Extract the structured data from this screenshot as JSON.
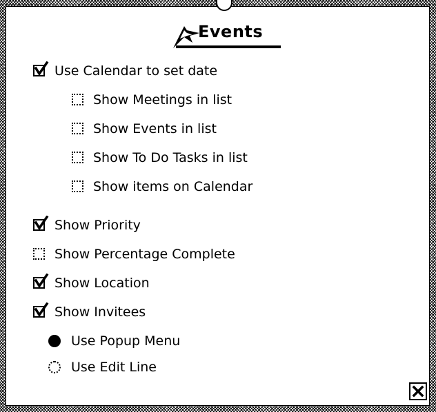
{
  "window": {
    "title": "Events"
  },
  "options": [
    {
      "label": "Use Calendar to set date",
      "checked": true
    },
    {
      "label": "Show Meetings in list",
      "checked": false
    },
    {
      "label": "Show Events in list",
      "checked": false
    },
    {
      "label": "Show To Do Tasks in list",
      "checked": false
    },
    {
      "label": "Show items on Calendar",
      "checked": false
    },
    {
      "label": "Show Priority",
      "checked": true
    },
    {
      "label": "Show Percentage Complete",
      "checked": false
    },
    {
      "label": "Show Location",
      "checked": true
    },
    {
      "label": "Show Invitees",
      "checked": true
    }
  ],
  "invitee_mode": [
    {
      "label": "Use Popup Menu",
      "selected": true
    },
    {
      "label": "Use Edit Line",
      "selected": false
    }
  ],
  "icons": {
    "title": "events-flag-icon",
    "close": "close-icon",
    "checkmark": "checkmark-icon"
  }
}
